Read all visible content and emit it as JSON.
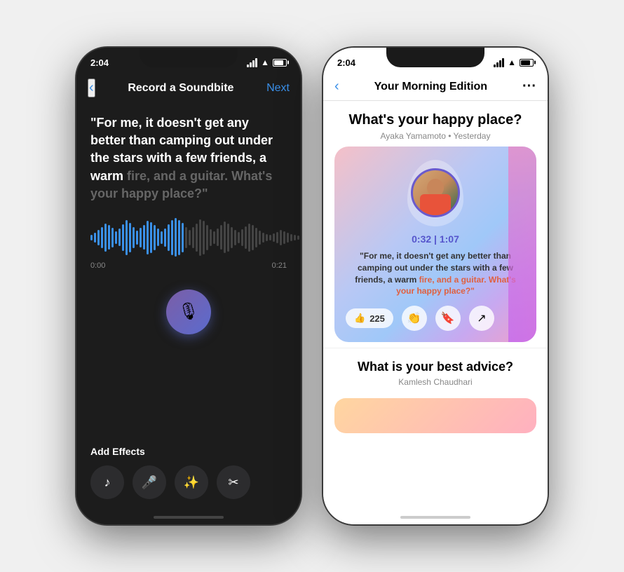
{
  "phone_left": {
    "status_time": "2:04",
    "nav_title": "Record a Soundbite",
    "nav_next": "Next",
    "soundbite_text_bold": "\"For me, it doesn't get any better than camping out under the stars with a few friends, a warm ",
    "soundbite_text_faded": "fire, and a guitar. What's your happy place?\"",
    "waveform_start": "0:00",
    "waveform_end": "0:21",
    "mic_icon": "🎙",
    "effects_title": "Add Effects",
    "effects": [
      {
        "icon": "♪",
        "label": "music-effect"
      },
      {
        "icon": "🎤",
        "label": "voice-effect"
      },
      {
        "icon": "✨",
        "label": "sparkle-effect"
      },
      {
        "icon": "✂",
        "label": "trim-effect"
      }
    ]
  },
  "phone_right": {
    "status_time": "2:04",
    "nav_title": "Your Morning Edition",
    "post1_title": "What's your happy place?",
    "post1_meta": "Ayaka Yamamoto • Yesterday",
    "card_time": "0:32 | 1:07",
    "card_quote_bold": "\"For me, it doesn't get any better than camping out under the stars with a few friends, a warm ",
    "card_quote_faded": "fire, and a guitar. What's your happy place?\"",
    "like_count": "225",
    "post2_title": "What is your best advice?",
    "post2_meta": "Kamlesh Chaudhari"
  }
}
